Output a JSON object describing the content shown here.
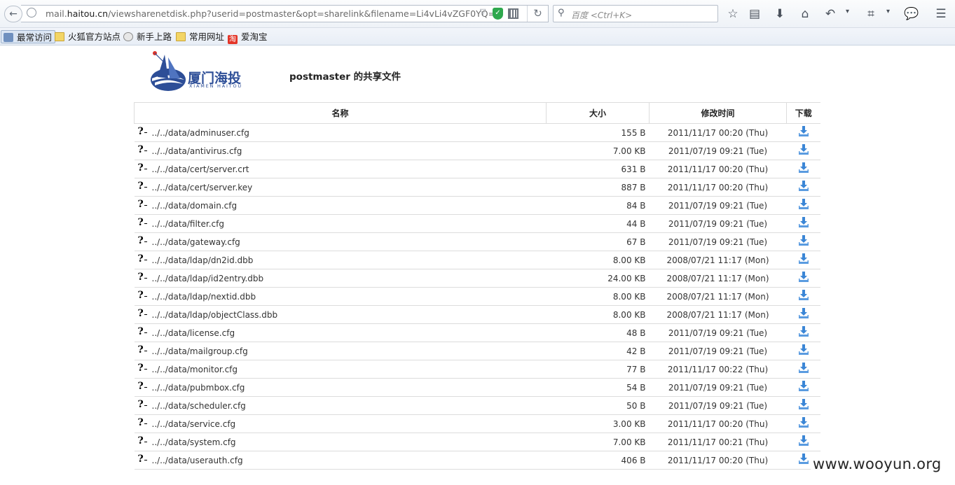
{
  "browser": {
    "url_prefix": "mail.",
    "url_domain": "haitou.cn",
    "url_path": "/viewsharenetdisk.php?userid=postmaster&opt=sharelink&filename=Li4vLi4vZGF0YQ==",
    "search_placeholder": "百度 <Ctrl+K>"
  },
  "bookmarks": [
    {
      "label": "最常访问",
      "icon": "frequent-icon"
    },
    {
      "label": "火狐官方站点",
      "icon": "folder-icon"
    },
    {
      "label": "新手上路",
      "icon": "globe-icon"
    },
    {
      "label": "常用网址",
      "icon": "folder-icon"
    },
    {
      "label": "爱淘宝",
      "icon": "taobao-icon"
    }
  ],
  "page": {
    "logo_text_cn": "厦门海投",
    "logo_text_en": "XIAMEN HAITOU",
    "title": "postmaster 的共享文件",
    "columns": {
      "name": "名称",
      "size": "大小",
      "mtime": "修改时间",
      "download": "下载"
    },
    "files": [
      {
        "name": "../../data/adminuser.cfg",
        "size": "155 B",
        "mtime": "2011/11/17 00:20 (Thu)"
      },
      {
        "name": "../../data/antivirus.cfg",
        "size": "7.00 KB",
        "mtime": "2011/07/19 09:21 (Tue)"
      },
      {
        "name": "../../data/cert/server.crt",
        "size": "631 B",
        "mtime": "2011/11/17 00:20 (Thu)"
      },
      {
        "name": "../../data/cert/server.key",
        "size": "887 B",
        "mtime": "2011/11/17 00:20 (Thu)"
      },
      {
        "name": "../../data/domain.cfg",
        "size": "84 B",
        "mtime": "2011/07/19 09:21 (Tue)"
      },
      {
        "name": "../../data/filter.cfg",
        "size": "44 B",
        "mtime": "2011/07/19 09:21 (Tue)"
      },
      {
        "name": "../../data/gateway.cfg",
        "size": "67 B",
        "mtime": "2011/07/19 09:21 (Tue)"
      },
      {
        "name": "../../data/ldap/dn2id.dbb",
        "size": "8.00 KB",
        "mtime": "2008/07/21 11:17 (Mon)"
      },
      {
        "name": "../../data/ldap/id2entry.dbb",
        "size": "24.00 KB",
        "mtime": "2008/07/21 11:17 (Mon)"
      },
      {
        "name": "../../data/ldap/nextid.dbb",
        "size": "8.00 KB",
        "mtime": "2008/07/21 11:17 (Mon)"
      },
      {
        "name": "../../data/ldap/objectClass.dbb",
        "size": "8.00 KB",
        "mtime": "2008/07/21 11:17 (Mon)"
      },
      {
        "name": "../../data/license.cfg",
        "size": "48 B",
        "mtime": "2011/07/19 09:21 (Tue)"
      },
      {
        "name": "../../data/mailgroup.cfg",
        "size": "42 B",
        "mtime": "2011/07/19 09:21 (Tue)"
      },
      {
        "name": "../../data/monitor.cfg",
        "size": "77 B",
        "mtime": "2011/11/17 00:22 (Thu)"
      },
      {
        "name": "../../data/pubmbox.cfg",
        "size": "54 B",
        "mtime": "2011/07/19 09:21 (Tue)"
      },
      {
        "name": "../../data/scheduler.cfg",
        "size": "50 B",
        "mtime": "2011/07/19 09:21 (Tue)"
      },
      {
        "name": "../../data/service.cfg",
        "size": "3.00 KB",
        "mtime": "2011/11/17 00:20 (Thu)"
      },
      {
        "name": "../../data/system.cfg",
        "size": "7.00 KB",
        "mtime": "2011/11/17 00:21 (Thu)"
      },
      {
        "name": "../../data/userauth.cfg",
        "size": "406 B",
        "mtime": "2011/11/17 00:20 (Thu)"
      }
    ]
  },
  "watermark": "www.wooyun.org",
  "colors": {
    "logo_blue": "#2d4e97",
    "download_blue": "#3b86d6",
    "shield_green": "#2ea84d",
    "taobao_red": "#e33528"
  }
}
